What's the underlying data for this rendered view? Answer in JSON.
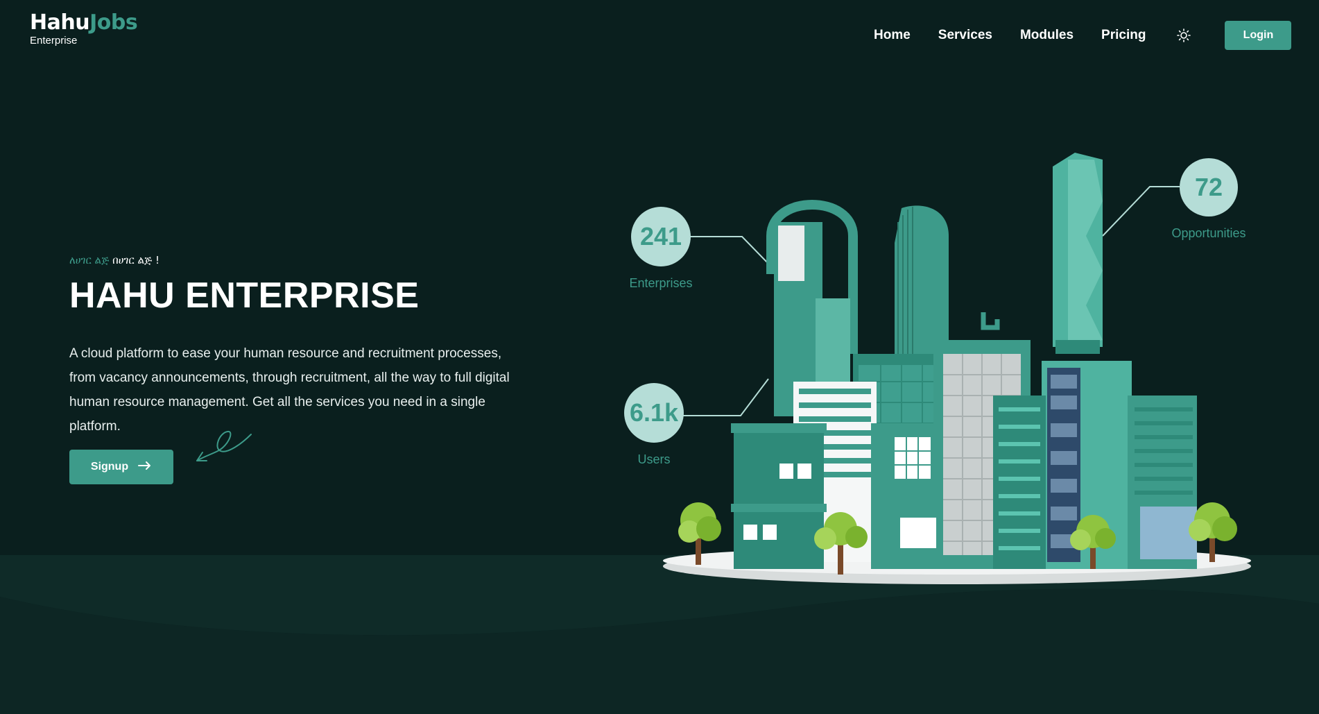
{
  "header": {
    "logo": {
      "main": "Hahu",
      "accent": "Jobs",
      "sub": "Enterprise"
    },
    "nav": [
      "Home",
      "Services",
      "Modules",
      "Pricing"
    ],
    "theme_icon": "sun-icon",
    "login_label": "Login"
  },
  "hero": {
    "tagline_part1": "ለሀገር ልጅ",
    "tagline_part2": "በሀገር ልጅ !",
    "title": "HAHU ENTERPRISE",
    "description": "A cloud platform to ease your human resource and recruitment processes, from vacancy announcements, through recruitment, all the way to full digital human resource management. Get all the services you need in a single platform.",
    "signup_label": "Signup",
    "signup_icon": "arrow-right-icon"
  },
  "stats": [
    {
      "value": "241",
      "label": "Enterprises"
    },
    {
      "value": "6.1k",
      "label": "Users"
    },
    {
      "value": "72",
      "label": "Opportunities"
    }
  ],
  "colors": {
    "background": "#0a1f1e",
    "accent": "#3d9b8a",
    "stat_circle": "#b5ddd7"
  }
}
